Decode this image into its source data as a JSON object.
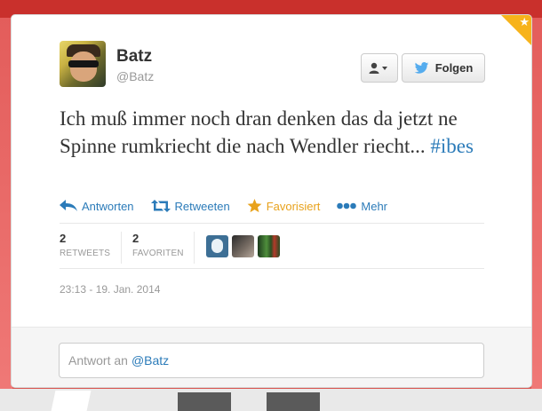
{
  "user": {
    "name": "Batz",
    "handle": "@Batz"
  },
  "buttons": {
    "follow_label": "Folgen"
  },
  "tweet": {
    "text": "Ich muß immer noch dran denken das da jetzt ne Spinne rumkriecht die nach Wendler riecht...",
    "hashtag": "#ibes"
  },
  "actions": {
    "reply": "Antworten",
    "retweet": "Retweeten",
    "favorite": "Favorisiert",
    "more": "Mehr"
  },
  "stats": {
    "retweets_count": "2",
    "retweets_label": "RETWEETS",
    "favorites_count": "2",
    "favorites_label": "FAVORITEN"
  },
  "timestamp": "23:13 - 19. Jan. 2014",
  "reply": {
    "prefix": "Antwort an",
    "mention": "@Batz"
  },
  "colors": {
    "link": "#2b7bb9",
    "favorite": "#e8a21c",
    "background": "#d9534f"
  },
  "icons": {
    "user_menu": "user-dropdown-icon",
    "follow": "twitter-bird-icon",
    "reply": "reply-arrow-icon",
    "retweet": "retweet-icon",
    "favorite": "star-icon",
    "more": "more-dots-icon",
    "corner": "favorited-corner-star-icon"
  }
}
